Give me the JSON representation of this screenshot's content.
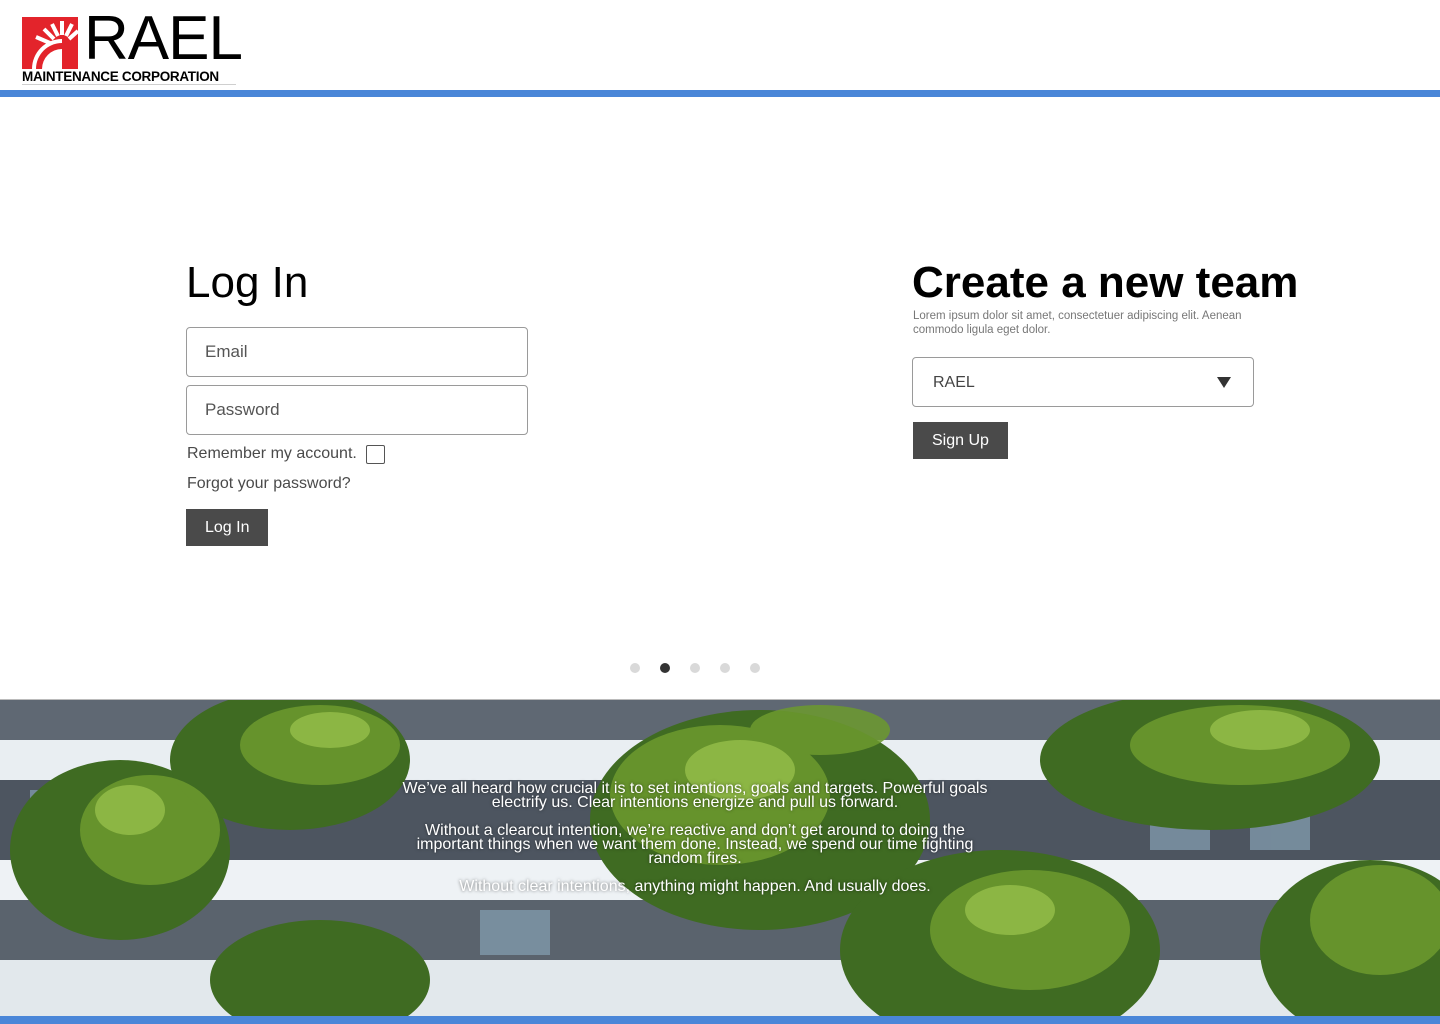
{
  "brand": {
    "name": "RAEL",
    "subtitle": "MAINTENANCE CORPORATION",
    "icon": "sunburst-logo-icon",
    "accent_color": "#e3242b"
  },
  "colors": {
    "header_bar": "#4a86d8",
    "button_bg": "#4a4a4a",
    "button_text": "#ffffff"
  },
  "login": {
    "title": "Log In",
    "email_placeholder": "Email",
    "password_placeholder": "Password",
    "remember_label": "Remember my account.",
    "remember_checked": false,
    "forgot_label": "Forgot your password?",
    "submit_label": "Log In"
  },
  "team": {
    "title": "Create a new team",
    "description": "Lorem ipsum dolor sit amet, consectetuer adipiscing elit. Aenean commodo ligula eget dolor.",
    "selected_option": "RAEL",
    "caret_icon": "triangle-down-icon",
    "submit_label": "Sign Up"
  },
  "carousel": {
    "total": 5,
    "active": 2
  },
  "hero": {
    "paragraphs": [
      "We’ve all heard how crucial it is to set intentions, goals and targets. Powerful goals electrify us. Clear intentions energize and pull us forward.",
      "Without a clearcut intention, we’re reactive and don’t get around to doing the important things when we want them done. Instead, we spend our time fighting random fires.",
      "Without clear intentions, anything might happen. And usually does."
    ]
  }
}
